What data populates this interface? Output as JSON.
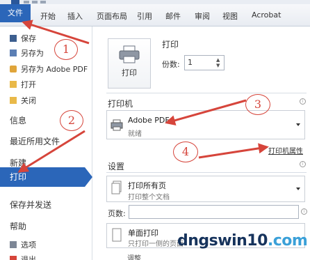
{
  "ribbon": {
    "file_tab": "文件",
    "tabs": [
      "开始",
      "插入",
      "页面布局",
      "引用",
      "邮件",
      "审阅",
      "视图",
      "Acrobat"
    ]
  },
  "nav": {
    "small_items": [
      {
        "label": "保存",
        "icon": "save-icon"
      },
      {
        "label": "另存为",
        "icon": "save-as-icon"
      },
      {
        "label": "另存为 Adobe PDF",
        "icon": "adobe-pdf-icon"
      },
      {
        "label": "打开",
        "icon": "folder-open-icon"
      },
      {
        "label": "关闭",
        "icon": "folder-close-icon"
      }
    ],
    "big_items": [
      "信息",
      "最近所用文件",
      "新建"
    ],
    "selected": "打印",
    "lower_items": [
      "保存并发送",
      "帮助"
    ],
    "bottom_items": [
      {
        "label": "选项",
        "icon": "options-icon"
      },
      {
        "label": "退出",
        "icon": "exit-icon"
      }
    ]
  },
  "print": {
    "section_title": "打印",
    "button_label": "打印",
    "copies_label": "份数:",
    "copies_value": "1"
  },
  "printer": {
    "section_title": "打印机",
    "name": "Adobe PDF",
    "status": "就绪",
    "properties_link": "打印机属性"
  },
  "settings": {
    "section_title": "设置",
    "print_all": {
      "main": "打印所有页",
      "sub": "打印整个文档"
    },
    "pages_label": "页数:",
    "one_sided": {
      "main": "单面打印",
      "sub": "只打印一侧的页面"
    },
    "collated_main": "调整"
  },
  "annotations": [
    "1",
    "2",
    "3",
    "4"
  ],
  "watermark": {
    "part1": "dngswin10",
    "part2": ".com"
  },
  "colors": {
    "accent": "#2b66b9",
    "annotation": "#d6453b"
  }
}
